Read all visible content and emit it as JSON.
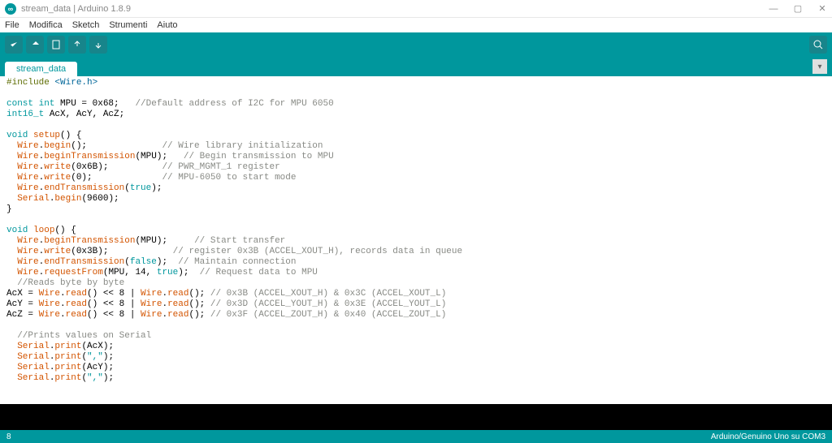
{
  "window": {
    "title": "stream_data | Arduino 1.8.9",
    "app_icon_glyph": "∞"
  },
  "menu": {
    "file": "File",
    "edit": "Modifica",
    "sketch": "Sketch",
    "tools": "Strumenti",
    "help": "Aiuto"
  },
  "tabs": {
    "active": "stream_data"
  },
  "code": {
    "l1_inc": "#include",
    "l1_lib": "<Wire.h>",
    "l2_ty": "const int",
    "l2_var": " MPU = 0x68;   ",
    "l2_com": "//Default address of I2C for MPU 6050",
    "l3_ty": "int16_t",
    "l3_var": " AcX, AcY, AcZ;",
    "l4_kw": "void",
    "l4_fn": "setup",
    "l4_rest": "() {",
    "l5_obj": "Wire",
    "l5_fn": "begin",
    "l5_rest": "();              ",
    "l5_com": "// Wire library initialization",
    "l6_obj": "Wire",
    "l6_fn": "beginTransmission",
    "l6_rest": "(MPU);   ",
    "l6_com": "// Begin transmission to MPU",
    "l7_obj": "Wire",
    "l7_fn": "write",
    "l7_rest": "(0x6B);          ",
    "l7_com": "// PWR_MGMT_1 register",
    "l8_obj": "Wire",
    "l8_fn": "write",
    "l8_rest": "(0);             ",
    "l8_com": "// MPU-6050 to start mode",
    "l9_obj": "Wire",
    "l9_fn": "endTransmission",
    "l9_arg": "true",
    "l10_obj": "Serial",
    "l10_fn": "begin",
    "l10_rest": "(9600);",
    "l11": "}",
    "l12_kw": "void",
    "l12_fn": "loop",
    "l12_rest": "() {",
    "l13_obj": "Wire",
    "l13_fn": "beginTransmission",
    "l13_rest": "(MPU);     ",
    "l13_com": "// Start transfer",
    "l14_obj": "Wire",
    "l14_fn": "write",
    "l14_rest": "(0x3B);            ",
    "l14_com": "// register 0x3B (ACCEL_XOUT_H), records data in queue",
    "l15_obj": "Wire",
    "l15_fn": "endTransmission",
    "l15_arg": "false",
    "l15_rest": ");  ",
    "l15_com": "// Maintain connection",
    "l16_obj": "Wire",
    "l16_fn": "requestFrom",
    "l16_rest": "(MPU, 14, ",
    "l16_arg": "true",
    "l16_rest2": ");  ",
    "l16_com": "// Request data to MPU",
    "l17_com": "//Reads byte by byte",
    "l18_var": "AcX = ",
    "l18_obj": "Wire",
    "l18_fn": "read",
    "l18_mid": "() << 8 | ",
    "l18_obj2": "Wire",
    "l18_fn2": "read",
    "l18_rest": "(); ",
    "l18_com": "// 0x3B (ACCEL_XOUT_H) & 0x3C (ACCEL_XOUT_L)",
    "l19_var": "AcY = ",
    "l19_com": "// 0x3D (ACCEL_YOUT_H) & 0x3E (ACCEL_YOUT_L)",
    "l20_var": "AcZ = ",
    "l20_com": "// 0x3F (ACCEL_ZOUT_H) & 0x40 (ACCEL_ZOUT_L)",
    "l21_com": "//Prints values on Serial",
    "l22_obj": "Serial",
    "l22_fn": "print",
    "l22_rest": "(AcX);",
    "l23_obj": "Serial",
    "l23_fn": "print",
    "l23_str": "\",\"",
    "l24_rest": "(AcY);",
    "l25_str": "\",\""
  },
  "status": {
    "left": "8",
    "right": "Arduino/Genuino Uno su COM3"
  }
}
